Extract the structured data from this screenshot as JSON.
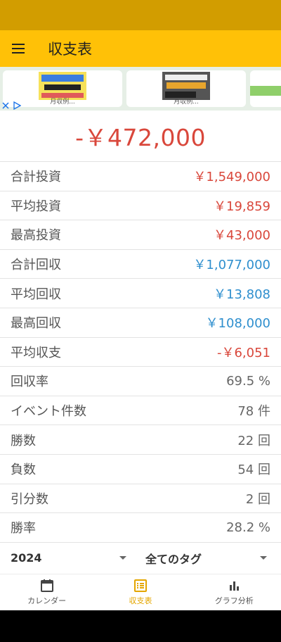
{
  "appbar": {
    "title": "収支表",
    "menu_icon": "hamburger-menu-icon"
  },
  "ads": [
    {
      "caption": "月収例..."
    },
    {
      "caption": "月収例..."
    }
  ],
  "balance": "-￥472,000",
  "stats": [
    {
      "label": "合計投資",
      "value": "￥1,549,000",
      "tone": "neg"
    },
    {
      "label": "平均投資",
      "value": "￥19,859",
      "tone": "neg"
    },
    {
      "label": "最高投資",
      "value": "￥43,000",
      "tone": "neg"
    },
    {
      "label": "合計回収",
      "value": "￥1,077,000",
      "tone": "pos"
    },
    {
      "label": "平均回収",
      "value": "￥13,808",
      "tone": "pos"
    },
    {
      "label": "最高回収",
      "value": "￥108,000",
      "tone": "pos"
    },
    {
      "label": "平均収支",
      "value": "-￥6,051",
      "tone": "neg"
    },
    {
      "label": "回収率",
      "value": "69.5 %",
      "tone": "plain"
    },
    {
      "label": "イベント件数",
      "value": "78 件",
      "tone": "plain"
    },
    {
      "label": "勝数",
      "value": "22 回",
      "tone": "plain"
    },
    {
      "label": "負数",
      "value": "54 回",
      "tone": "plain"
    },
    {
      "label": "引分数",
      "value": "2 回",
      "tone": "plain"
    },
    {
      "label": "勝率",
      "value": "28.2 %",
      "tone": "plain"
    }
  ],
  "filters": {
    "year": "2024",
    "tag": "全てのタグ"
  },
  "nav": [
    {
      "label": "カレンダー",
      "icon": "calendar-icon",
      "active": false
    },
    {
      "label": "収支表",
      "icon": "list-icon",
      "active": true
    },
    {
      "label": "グラフ分析",
      "icon": "bar-chart-icon",
      "active": false
    }
  ],
  "colors": {
    "appbar": "#ffc107",
    "statusbar": "#d29d00",
    "negative": "#d9473b",
    "positive": "#2f8fce",
    "active_nav": "#e4a600"
  }
}
